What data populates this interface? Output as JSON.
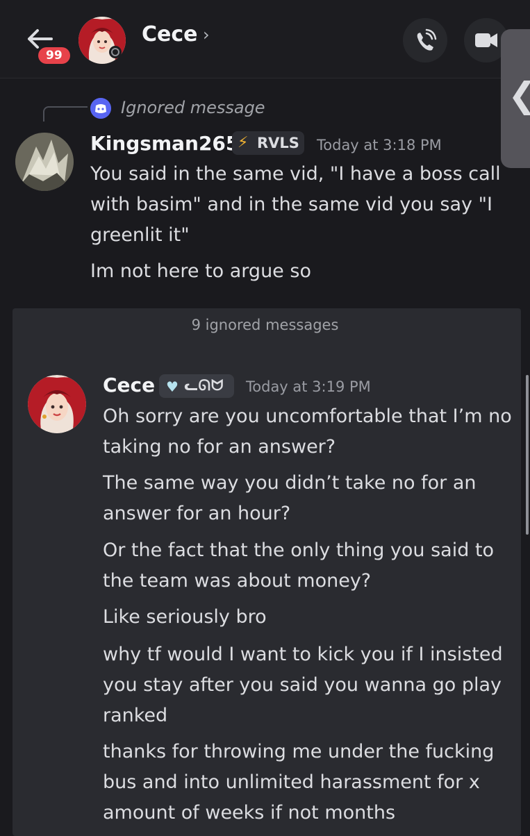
{
  "header": {
    "unread_badge": "99",
    "title": "Cece",
    "chevron": "›",
    "icons": [
      "back-arrow-icon",
      "phone-call-icon",
      "video-camera-icon"
    ]
  },
  "side_tab": {
    "glyph": "❮"
  },
  "messages": [
    {
      "reply_text": "Ignored message",
      "author": "Kingsman265",
      "tag": "RVLS",
      "timestamp": "Today at 3:18 PM",
      "lines": [
        "You said in the same vid, \"I have a boss call",
        "with basim\" and in the same vid you say \"I",
        "greenlit it\"",
        "Im not here to argue so"
      ]
    }
  ],
  "ignored": {
    "label": "9 ignored messages",
    "author": "Cece",
    "tag": "ᓚᘏᗢ",
    "timestamp": "Today at 3:19 PM",
    "lines": [
      "Oh sorry are you uncomfortable that I’m no",
      "taking no for an answer?",
      "The same way you didn’t take no for an",
      "answer for an hour?",
      "Or the fact that the only thing you said to",
      "the team was about money?",
      "Like seriously bro",
      "why tf would I want to kick you if I insisted",
      "you stay after you said you wanna go play",
      "ranked",
      "thanks for throwing me under the fucking",
      "bus and into unlimited harassment for x",
      "amount of weeks if not months"
    ]
  },
  "colors": {
    "badge": "#e7424a",
    "blurple": "#5865f2",
    "bolt": "#f0b232"
  }
}
